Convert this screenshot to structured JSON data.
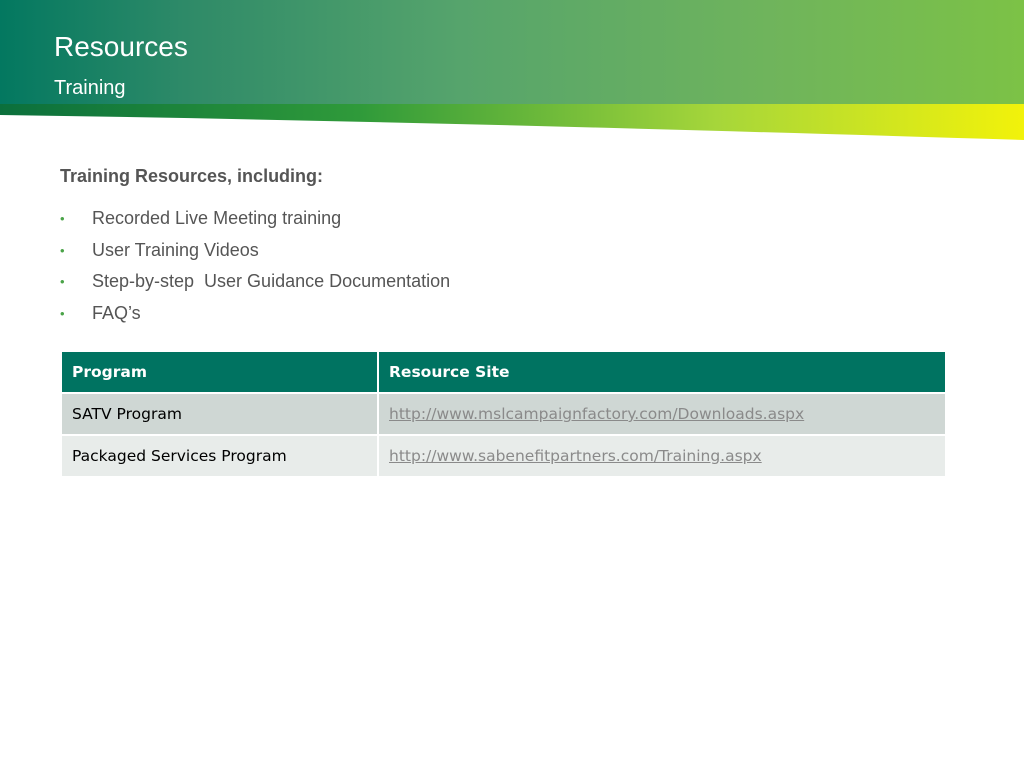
{
  "header": {
    "title": "Resources",
    "subtitle": "Training"
  },
  "colors": {
    "header_start": "#037860",
    "header_end": "#7cc246",
    "swoosh_yellow": "#f2f20a",
    "table_header": "#007361",
    "row_odd": "#cfd7d4",
    "row_even": "#e8ecea",
    "bullet": "#4aa348"
  },
  "content": {
    "intro": "Training Resources, including:",
    "bullets": [
      "Recorded Live Meeting training",
      "User Training Videos",
      "Step-by-step  User Guidance Documentation",
      "FAQ’s"
    ]
  },
  "table": {
    "headers": [
      "Program",
      "Resource Site"
    ],
    "rows": [
      {
        "program": "SATV Program",
        "site": "http://www.mslcampaignfactory.com/Downloads.aspx"
      },
      {
        "program": "Packaged Services Program",
        "site": "http://www.sabenefitpartners.com/Training.aspx"
      }
    ]
  }
}
